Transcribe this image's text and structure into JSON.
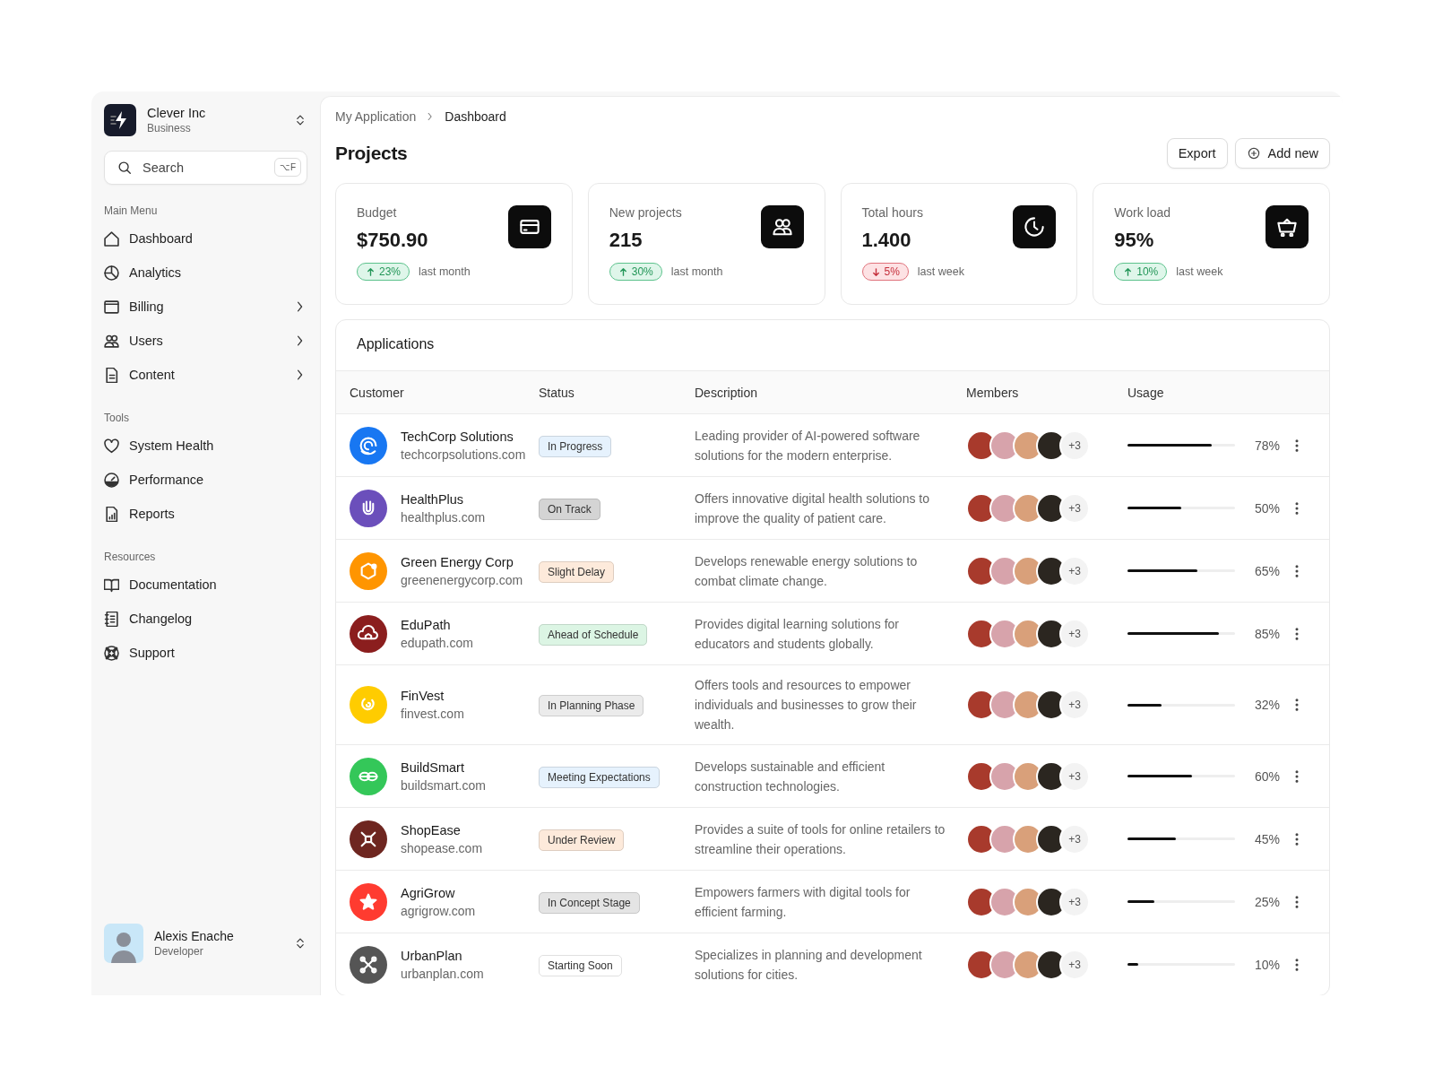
{
  "workspace": {
    "name": "Clever Inc",
    "plan": "Business"
  },
  "search": {
    "placeholder": "Search",
    "shortcut": "⌥F"
  },
  "sidebar": {
    "sections": [
      {
        "title": "Main Menu",
        "items": [
          {
            "label": "Dashboard",
            "has_submenu": false
          },
          {
            "label": "Analytics",
            "has_submenu": false
          },
          {
            "label": "Billing",
            "has_submenu": true
          },
          {
            "label": "Users",
            "has_submenu": true
          },
          {
            "label": "Content",
            "has_submenu": true
          }
        ]
      },
      {
        "title": "Tools",
        "items": [
          {
            "label": "System Health",
            "has_submenu": false
          },
          {
            "label": "Performance",
            "has_submenu": false
          },
          {
            "label": "Reports",
            "has_submenu": false
          }
        ]
      },
      {
        "title": "Resources",
        "items": [
          {
            "label": "Documentation",
            "has_submenu": false
          },
          {
            "label": "Changelog",
            "has_submenu": false
          },
          {
            "label": "Support",
            "has_submenu": false
          }
        ]
      }
    ]
  },
  "user": {
    "name": "Alexis Enache",
    "role": "Developer"
  },
  "breadcrumb": [
    "My Application",
    "Dashboard"
  ],
  "page_title": "Projects",
  "actions": [
    {
      "label": "Export",
      "kind": "plain"
    },
    {
      "label": "Add new",
      "kind": "add"
    }
  ],
  "stats": [
    {
      "label": "Budget",
      "value": "$750.90",
      "change": {
        "kind": "up",
        "value": "23%"
      },
      "period": "last month"
    },
    {
      "label": "New projects",
      "value": "215",
      "change": {
        "kind": "up",
        "value": "30%"
      },
      "period": "last month"
    },
    {
      "label": "Total hours",
      "value": "1.400",
      "change": {
        "kind": "down",
        "value": "5%"
      },
      "period": "last week"
    },
    {
      "label": "Work load",
      "value": "95%",
      "change": {
        "kind": "up",
        "value": "10%"
      },
      "period": "last week"
    }
  ],
  "applications": {
    "title": "Applications",
    "columns": [
      "Customer",
      "Status",
      "Description",
      "Members",
      "Usage"
    ],
    "rows": [
      {
        "name": "TechCorp Solutions",
        "domain": "techcorpsolutions.com",
        "color": "#1877f2",
        "status": {
          "label": "In Progress",
          "color": "#e6f2fd"
        },
        "description": "Leading provider of AI-powered software solutions for the modern enterprise.",
        "members_more": "+3",
        "usage": {
          "level": 0.78,
          "reading": "78%"
        }
      },
      {
        "name": "HealthPlus",
        "domain": "healthplus.com",
        "color": "#6b4fbb",
        "status": {
          "label": "On Track",
          "color": "#d4d4d4"
        },
        "description": "Offers innovative digital health solutions to improve the quality of patient care.",
        "members_more": "+3",
        "usage": {
          "level": 0.5,
          "reading": "50%"
        }
      },
      {
        "name": "Green Energy Corp",
        "domain": "greenenergycorp.com",
        "color": "#ff9500",
        "status": {
          "label": "Slight Delay",
          "color": "#fdeadb"
        },
        "description": "Develops renewable energy solutions to combat climate change.",
        "members_more": "+3",
        "usage": {
          "level": 0.65,
          "reading": "65%"
        }
      },
      {
        "name": "EduPath",
        "domain": "edupath.com",
        "color": "#8b1e1e",
        "status": {
          "label": "Ahead of Schedule",
          "color": "#dcf5e4"
        },
        "description": "Provides digital learning solutions for educators and students globally.",
        "members_more": "+3",
        "usage": {
          "level": 0.85,
          "reading": "85%"
        }
      },
      {
        "name": "FinVest",
        "domain": "finvest.com",
        "color": "#ffcc00",
        "status": {
          "label": "In Planning Phase",
          "color": "#ebebeb"
        },
        "description": "Offers tools and resources to empower individuals and businesses to grow their wealth.",
        "members_more": "+3",
        "usage": {
          "level": 0.32,
          "reading": "32%"
        }
      },
      {
        "name": "BuildSmart",
        "domain": "buildsmart.com",
        "color": "#34c759",
        "status": {
          "label": "Meeting Expectations",
          "color": "#e6f2fd"
        },
        "description": "Develops sustainable and efficient construction technologies.",
        "members_more": "+3",
        "usage": {
          "level": 0.6,
          "reading": "60%"
        }
      },
      {
        "name": "ShopEase",
        "domain": "shopease.com",
        "color": "#6e2620",
        "status": {
          "label": "Under Review",
          "color": "#fdeadb"
        },
        "description": "Provides a suite of tools for online retailers to streamline their operations.",
        "members_more": "+3",
        "usage": {
          "level": 0.45,
          "reading": "45%"
        }
      },
      {
        "name": "AgriGrow",
        "domain": "agrigrow.com",
        "color": "#ff3b30",
        "status": {
          "label": "In Concept Stage",
          "color": "#e4e4e4"
        },
        "description": "Empowers farmers with digital tools for efficient farming.",
        "members_more": "+3",
        "usage": {
          "level": 0.25,
          "reading": "25%"
        }
      },
      {
        "name": "UrbanPlan",
        "domain": "urbanplan.com",
        "color": "#555555",
        "status": {
          "label": "Starting Soon",
          "color": "#ffffff"
        },
        "description": "Specializes in planning and development solutions for cities.",
        "members_more": "+3",
        "usage": {
          "level": 0.1,
          "reading": "10%"
        }
      }
    ]
  }
}
